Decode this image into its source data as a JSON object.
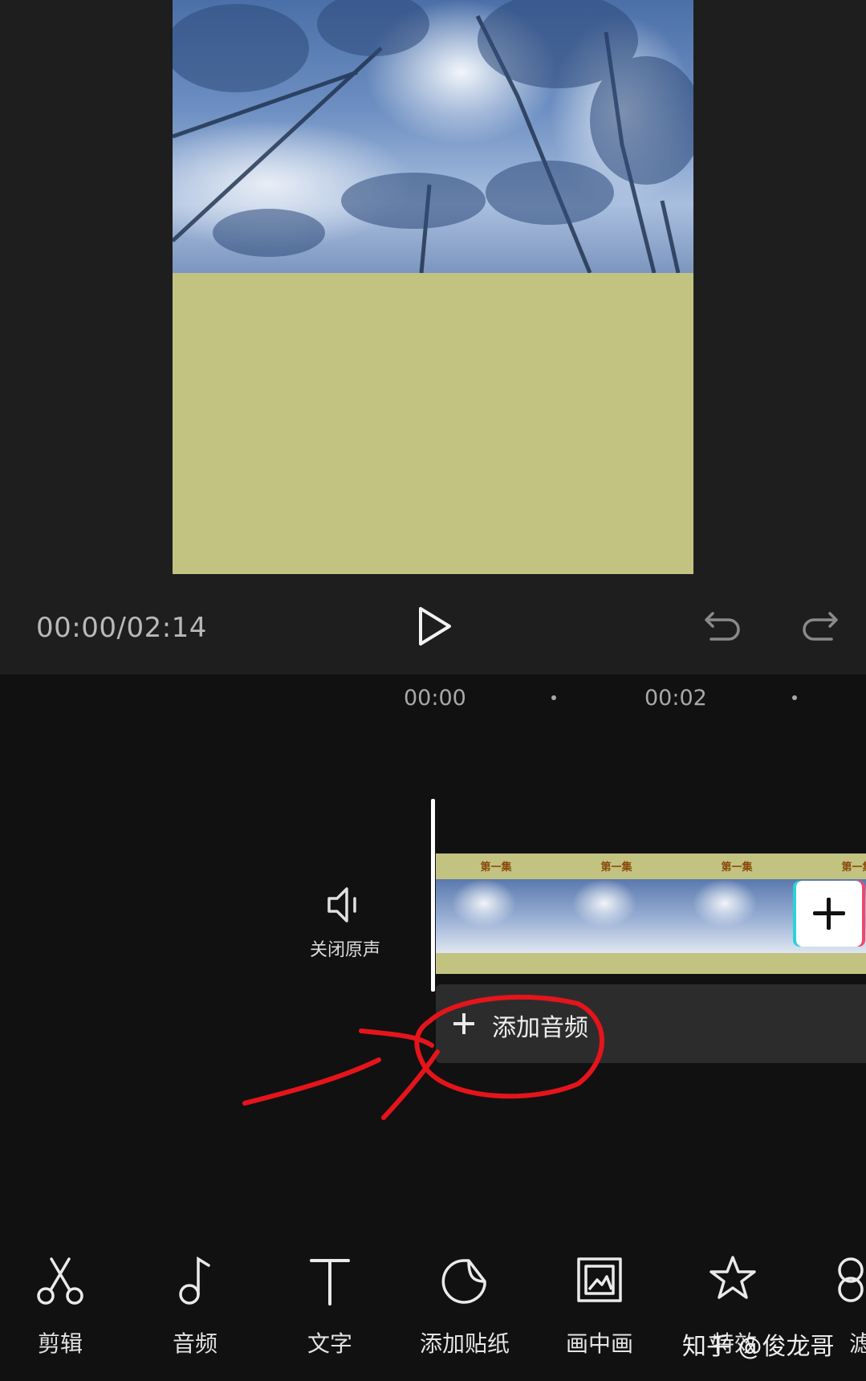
{
  "player": {
    "timecode": "00:00/02:14",
    "colors": {
      "padding_color": "#c2c381",
      "preview_bg": "#1e1e1f"
    }
  },
  "timeline": {
    "ruler": {
      "mark_1": "00:00",
      "mark_2": "00:02"
    },
    "mute_label": "关闭原声",
    "clip_caption": "第一集",
    "add_audio_label": "添加音频",
    "accent_colors": {
      "annotation_red": "#e5141b",
      "add_clip_left": "#27d4da",
      "add_clip_right": "#f0486b"
    }
  },
  "toolbar": {
    "items": [
      {
        "label": "剪辑",
        "icon": "scissors-icon"
      },
      {
        "label": "音频",
        "icon": "music-note-icon"
      },
      {
        "label": "文字",
        "icon": "text-t-icon"
      },
      {
        "label": "添加贴纸",
        "icon": "sticker-icon"
      },
      {
        "label": "画中画",
        "icon": "picture-in-picture-icon"
      },
      {
        "label": "特效",
        "icon": "star-effect-icon"
      },
      {
        "label": "滤",
        "icon": "filter-icon"
      }
    ]
  },
  "watermark": "知乎 @俊龙哥"
}
